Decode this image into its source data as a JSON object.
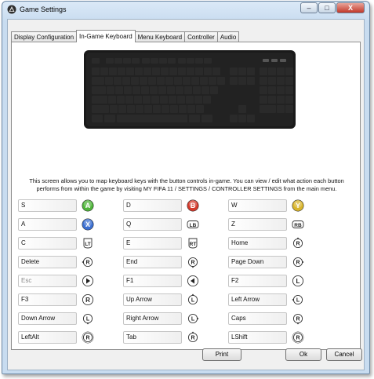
{
  "window": {
    "title": "Game Settings",
    "minimize": "–",
    "maximize": "□",
    "close": "X"
  },
  "tabs": [
    {
      "label": "Display Configuration",
      "active": false
    },
    {
      "label": "In-Game Keyboard",
      "active": true
    },
    {
      "label": "Menu Keyboard",
      "active": false
    },
    {
      "label": "Controller",
      "active": false
    },
    {
      "label": "Audio",
      "active": false
    }
  ],
  "description": {
    "line1": "This screen allows you to map keyboard keys with the button controls in-game. You can view / edit what action each button",
    "line2": "performs from within the game by visiting MY FIFA 11 / SETTINGS / CONTROLLER SETTINGS from the main menu."
  },
  "bindings": [
    {
      "key": "S",
      "control": "A",
      "kind": "face",
      "color": "#4fb53a"
    },
    {
      "key": "D",
      "control": "B",
      "kind": "face",
      "color": "#d43a2c"
    },
    {
      "key": "W",
      "control": "Y",
      "kind": "face",
      "color": "#d9b52c"
    },
    {
      "key": "A",
      "control": "X",
      "kind": "face",
      "color": "#3b6fd1"
    },
    {
      "key": "Q",
      "control": "LB",
      "kind": "bumper"
    },
    {
      "key": "Z",
      "control": "RB",
      "kind": "bumper"
    },
    {
      "key": "C",
      "control": "LT",
      "kind": "trigger"
    },
    {
      "key": "E",
      "control": "RT",
      "kind": "trigger"
    },
    {
      "key": "Home",
      "control": "right-stick-up",
      "kind": "stick"
    },
    {
      "key": "Delete",
      "control": "right-stick-left",
      "kind": "stick"
    },
    {
      "key": "End",
      "control": "right-stick-down",
      "kind": "stick"
    },
    {
      "key": "Page Down",
      "control": "right-stick-right",
      "kind": "stick"
    },
    {
      "key": "Esc",
      "control": "start",
      "kind": "play",
      "disabled": true
    },
    {
      "key": "F1",
      "control": "back",
      "kind": "back"
    },
    {
      "key": "F2",
      "control": "L",
      "kind": "letter"
    },
    {
      "key": "F3",
      "control": "R",
      "kind": "letter"
    },
    {
      "key": "Up Arrow",
      "control": "left-stick-up",
      "kind": "stick"
    },
    {
      "key": "Left Arrow",
      "control": "left-stick-left",
      "kind": "stick"
    },
    {
      "key": "Down Arrow",
      "control": "left-stick-down",
      "kind": "stick"
    },
    {
      "key": "Right Arrow",
      "control": "left-stick-right",
      "kind": "stick"
    },
    {
      "key": "Caps",
      "control": "right-stick-down",
      "kind": "stick"
    },
    {
      "key": "LeftAlt",
      "control": "right-stick-press",
      "kind": "stick"
    },
    {
      "key": "Tab",
      "control": "right-stick-up",
      "kind": "stick"
    },
    {
      "key": "LShift",
      "control": "right-stick-press",
      "kind": "stick"
    }
  ],
  "buttons": {
    "print": "Print",
    "ok": "Ok",
    "cancel": "Cancel"
  },
  "colors": {
    "keyboard_body": "#1a1a1a",
    "key_top": "#2a2a2a",
    "led": "#555555"
  }
}
